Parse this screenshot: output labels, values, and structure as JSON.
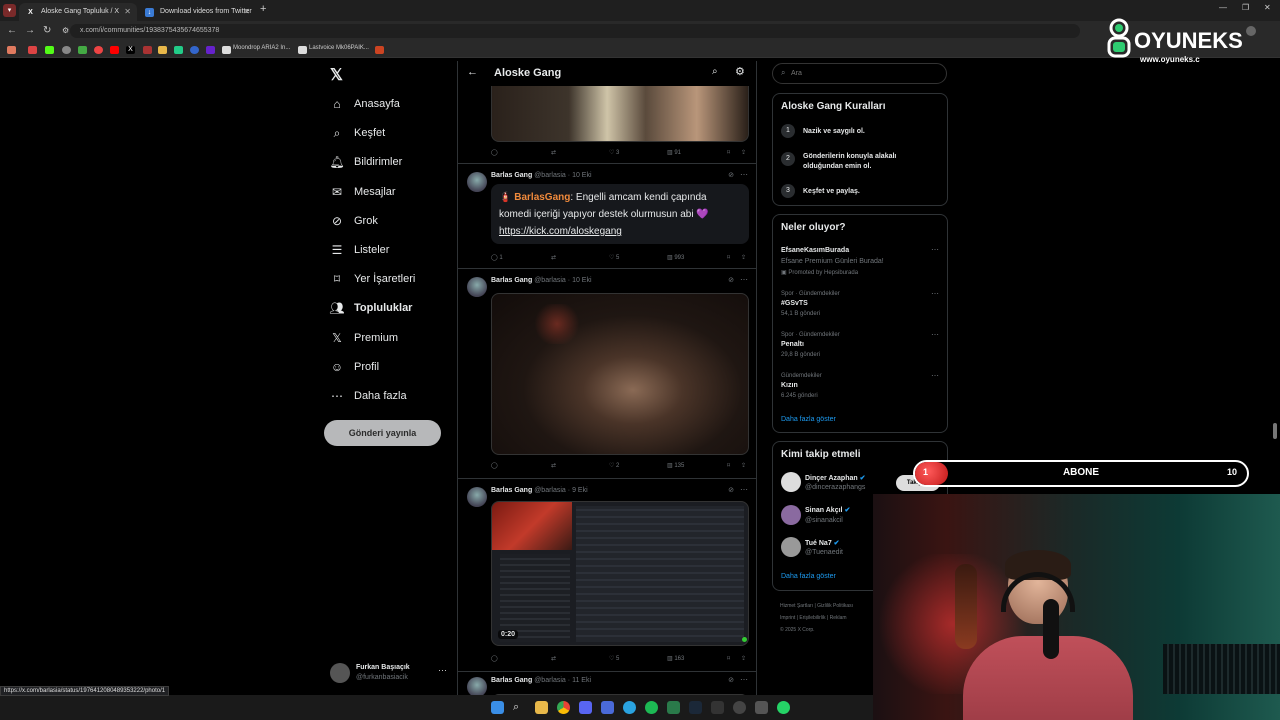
{
  "browser": {
    "tabs": [
      {
        "label": "Aloske Gang Topluluk / X",
        "active": true
      },
      {
        "label": "Download videos from Twitter",
        "active": false
      }
    ],
    "url": "x.com/i/communities/1938375435674655378",
    "bookmarks": [
      "Moondrop ARIA2 In...",
      "Lastvoice Mk06PAIK..."
    ],
    "status_url": "https://x.com/barlasia/status/1976412080489353222/photo/1"
  },
  "nav": {
    "items": [
      {
        "label": "Anasayfa",
        "icon": "home-icon"
      },
      {
        "label": "Keşfet",
        "icon": "search-icon"
      },
      {
        "label": "Bildirimler",
        "icon": "bell-icon"
      },
      {
        "label": "Mesajlar",
        "icon": "mail-icon"
      },
      {
        "label": "Grok",
        "icon": "grok-icon"
      },
      {
        "label": "Listeler",
        "icon": "list-icon"
      },
      {
        "label": "Yer İşaretleri",
        "icon": "bookmark-icon"
      },
      {
        "label": "Topluluklar",
        "icon": "communities-icon"
      },
      {
        "label": "Premium",
        "icon": "x-icon"
      },
      {
        "label": "Profil",
        "icon": "user-icon"
      },
      {
        "label": "Daha fazla",
        "icon": "more-icon"
      }
    ],
    "post_button": "Gönderi yayınla",
    "account": {
      "name": "Furkan Başıaçık",
      "handle": "@furkanbasiacik"
    }
  },
  "feed": {
    "title": "Aloske Gang",
    "posts": [
      {
        "replies": "",
        "reposts": "",
        "likes": "3",
        "views": "91"
      },
      {
        "name": "Barlas Gang",
        "handle": "@barlasia",
        "date": "10 Eki",
        "mention": "BarlasGang",
        "text": ": Engelli amcam kendi çapında komedi içeriği yapıyor destek olurmusun abi 💜",
        "link": "https://kick.com/aloskegang",
        "replies": "1",
        "reposts": "",
        "likes": "5",
        "views": "993"
      },
      {
        "name": "Barlas Gang",
        "handle": "@barlasia",
        "date": "10 Eki",
        "replies": "",
        "reposts": "",
        "likes": "2",
        "views": "135"
      },
      {
        "name": "Barlas Gang",
        "handle": "@barlasia",
        "date": "9 Eki",
        "video_time": "0:20",
        "replies": "",
        "reposts": "",
        "likes": "5",
        "views": "163"
      },
      {
        "name": "Barlas Gang",
        "handle": "@barlasia",
        "date": "11 Eki"
      }
    ]
  },
  "right": {
    "search_placeholder": "Ara",
    "rules": {
      "title": "Aloske Gang Kuralları",
      "items": [
        {
          "num": "1",
          "text": "Nazik ve saygılı ol."
        },
        {
          "num": "2",
          "text": "Gönderilerin konuyla alakalı olduğundan emin ol."
        },
        {
          "num": "3",
          "text": "Keşfet ve paylaş."
        }
      ]
    },
    "trends": {
      "title": "Neler oluyor?",
      "items": [
        {
          "name": "EfsaneKasımBurada",
          "sub": "Efsane Premium Günleri Burada!",
          "promo": "Promoted by Hepsiburada"
        },
        {
          "cat": "Spor · Gündemdekiler",
          "name": "#GSvTS",
          "count": "54,1 B gönderi"
        },
        {
          "cat": "Spor · Gündemdekiler",
          "name": "Penaltı",
          "count": "29,8 B gönderi"
        },
        {
          "cat": "Gündemdekiler",
          "name": "Kızın",
          "count": "6.245 gönderi"
        }
      ],
      "more": "Daha fazla göster"
    },
    "follow": {
      "title": "Kimi takip etmeli",
      "items": [
        {
          "name": "Dinçer Azaphan",
          "handle": "@dincerazaphangs"
        },
        {
          "name": "Sinan Akçıl",
          "handle": "@sinanakcil"
        },
        {
          "name": "Tué Na7",
          "handle": "@Tuenaedit"
        }
      ],
      "follow_label": "Takip et",
      "more": "Daha fazla göster"
    },
    "footer": [
      "Hizmet Şartları",
      "Gizlilik Politikası",
      "Imprint",
      "Erişilebilirlik",
      "Reklam",
      "© 2025 X Corp."
    ]
  },
  "overlay": {
    "brand": "OYUNEKS",
    "brand_url": "www.oyuneks.c",
    "sub_left": "1",
    "sub_label": "ABONE",
    "sub_right": "10",
    "sub_progress": 0.1
  }
}
